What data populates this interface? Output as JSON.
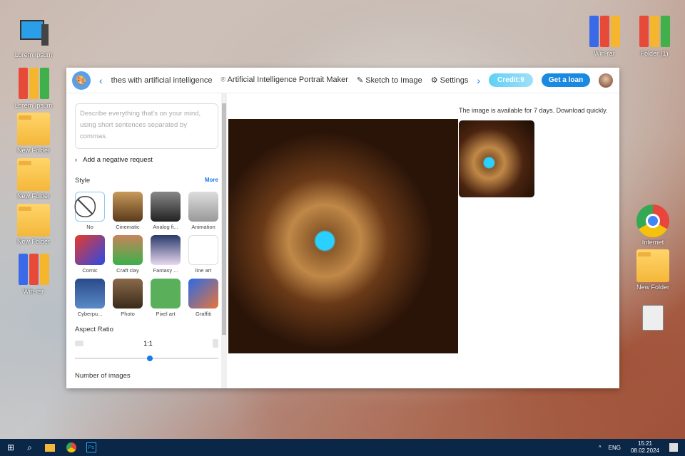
{
  "desktop": {
    "left": [
      "Lorem Ipsum",
      "Lorem Ipsum",
      "New Folder",
      "New Folder",
      "New Folder",
      "Win-rar"
    ],
    "right": [
      "Win-rar",
      "Folder (1)",
      "Internet",
      "New Folder"
    ]
  },
  "header": {
    "tabs": [
      "thes with artificial intelligence",
      "Artificial Intelligence Portrait Maker",
      "Sketch to Image",
      "Settings"
    ],
    "credit": "Credit:9",
    "loan": "Get a loan"
  },
  "sidebar": {
    "placeholder": "Describe everything that's on your mind, using short sentences separated by commas.",
    "negative": "Add a negative request",
    "style_label": "Style",
    "more": "More",
    "styles": [
      "No",
      "Cinematic",
      "Analog fi...",
      "Animation",
      "Comic",
      "Craft clay",
      "Fantasy ...",
      "line art",
      "Cyberpu...",
      "Photo",
      "Pixel art",
      "Graffiti"
    ],
    "aspect_label": "Aspect Ratio",
    "aspect_value": "1:1",
    "aspect_slider": 0.5,
    "num_images": "Number of images"
  },
  "main": {
    "notice": "The image is available for 7 days. Download quickly."
  },
  "taskbar": {
    "lang": "ENG",
    "time": "15:21",
    "date": "08.02.2024"
  }
}
